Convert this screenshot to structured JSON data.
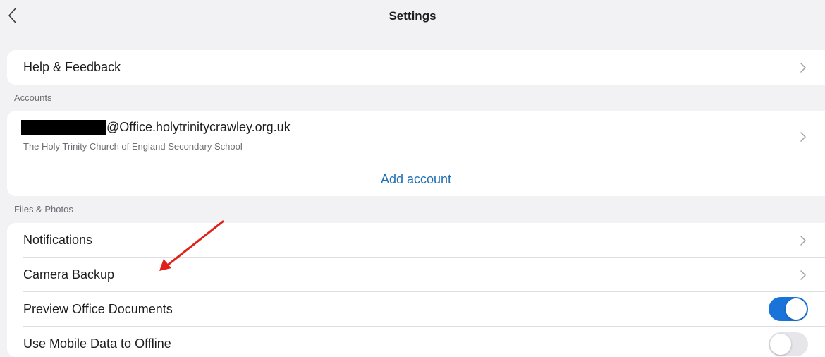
{
  "header": {
    "title": "Settings",
    "back_icon": "chevron-left-icon"
  },
  "help": {
    "label": "Help & Feedback"
  },
  "accounts": {
    "section_title": "Accounts",
    "email_suffix": "@Office.holytrinitycrawley.org.uk",
    "organization": "The Holy Trinity Church of England Secondary School",
    "add_account_label": "Add account"
  },
  "files_photos": {
    "section_title": "Files & Photos",
    "items": [
      {
        "label": "Notifications",
        "control": "chevron"
      },
      {
        "label": "Camera Backup",
        "control": "chevron"
      },
      {
        "label": "Preview Office Documents",
        "control": "toggle",
        "on": true
      },
      {
        "label": "Use Mobile Data to Offline",
        "control": "toggle",
        "on": false
      }
    ]
  },
  "colors": {
    "accent": "#1f6fb2",
    "toggle_on": "#1a73d9",
    "toggle_off": "#e5e5ea",
    "annotation_arrow": "#e0201b"
  }
}
